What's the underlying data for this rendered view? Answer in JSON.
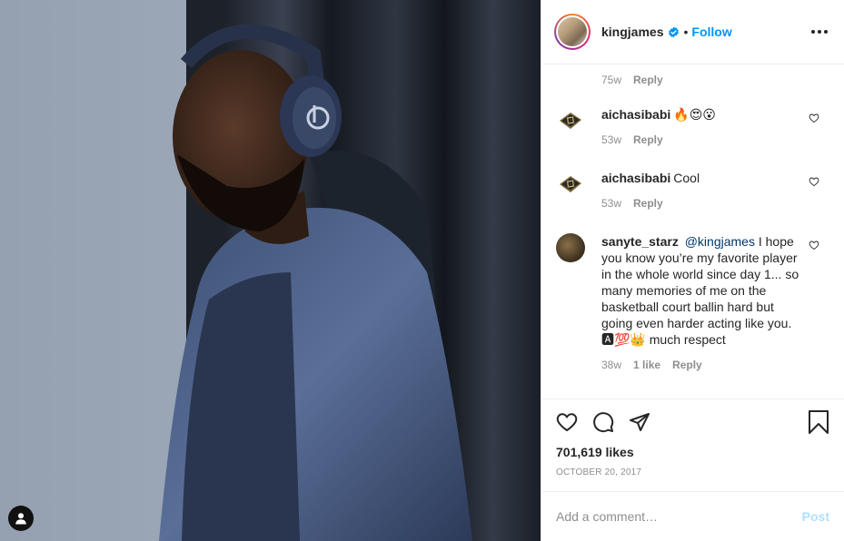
{
  "header": {
    "username": "kingjames",
    "separator": "•",
    "follow_label": "Follow"
  },
  "top_comment_meta": {
    "time": "75w",
    "reply_label": "Reply"
  },
  "comments": [
    {
      "username": "aichasibabi",
      "text": "🔥😍😮",
      "time": "53w",
      "reply_label": "Reply"
    },
    {
      "username": "aichasibabi",
      "text": "Cool",
      "time": "53w",
      "reply_label": "Reply"
    },
    {
      "username": "sanyte_starz",
      "mention": "@kingjames",
      "text": "I hope you know you’re my favorite player in the whole world since day 1... so many memories of me on the basketball court ballin hard but going even harder acting like you. 🅰💯👑 much respect",
      "time": "38w",
      "likes": "1 like",
      "reply_label": "Reply"
    }
  ],
  "post": {
    "likes": "701,619 likes",
    "date": "October 20, 2017"
  },
  "composer": {
    "placeholder": "Add a comment…",
    "post_label": "Post"
  },
  "colors": {
    "accent": "#0095f6",
    "post_disabled": "#b2dffc",
    "muted": "#8e8e8e"
  }
}
